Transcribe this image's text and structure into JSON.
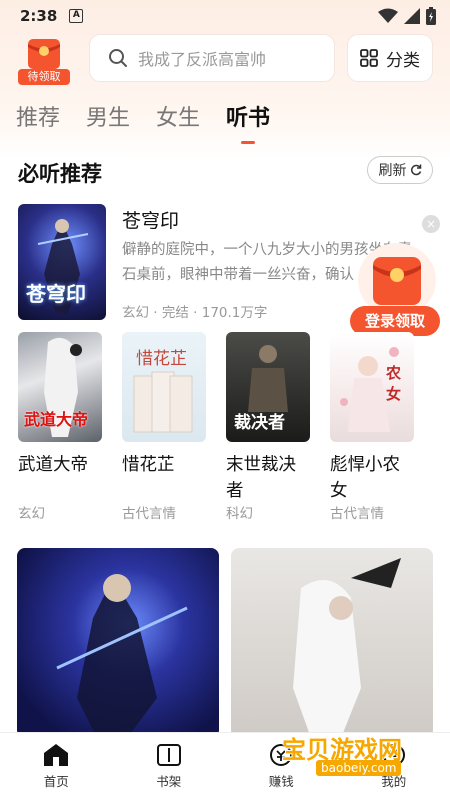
{
  "status_bar": {
    "time": "2:38",
    "notif_letter": "A"
  },
  "header": {
    "redpacket_label": "待领取",
    "search_placeholder": "我成了反派高富帅",
    "category_label": "分类"
  },
  "tabs": [
    {
      "label": "推荐",
      "active": false
    },
    {
      "label": "男生",
      "active": false
    },
    {
      "label": "女生",
      "active": false
    },
    {
      "label": "听书",
      "active": true
    }
  ],
  "section": {
    "title": "必听推荐",
    "refresh_label": "刷新"
  },
  "featured": {
    "title": "苍穹印",
    "description": "僻静的庭院中，一个八九岁大小的男孩坐在青石桌前，眼神中带着一丝兴奋，确认",
    "meta": "玄幻 · 完结 · 170.1万字",
    "cover_text": "苍穹印"
  },
  "floating_reward": {
    "label": "登录领取"
  },
  "grid_books": [
    {
      "title": "武道大帝",
      "genre": "玄幻",
      "cover_text": "武道大帝"
    },
    {
      "title": "惜花芷",
      "genre": "古代言情",
      "cover_text": "惜花芷"
    },
    {
      "title": "末世裁决者",
      "genre": "科幻",
      "cover_text": "裁决者"
    },
    {
      "title": "彪悍小农女",
      "genre": "古代言情",
      "cover_text": "农女"
    }
  ],
  "bottom_nav": [
    {
      "label": "首页",
      "icon": "home-icon",
      "active": true
    },
    {
      "label": "书架",
      "icon": "bookshelf-icon",
      "active": false
    },
    {
      "label": "赚钱",
      "icon": "earn-icon",
      "active": false
    },
    {
      "label": "我的",
      "icon": "profile-icon",
      "active": false
    }
  ],
  "watermark": {
    "text": "宝贝游戏网",
    "url": "baobeiy.com"
  },
  "colors": {
    "accent": "#f4552f",
    "watermark": "#f6a800"
  }
}
